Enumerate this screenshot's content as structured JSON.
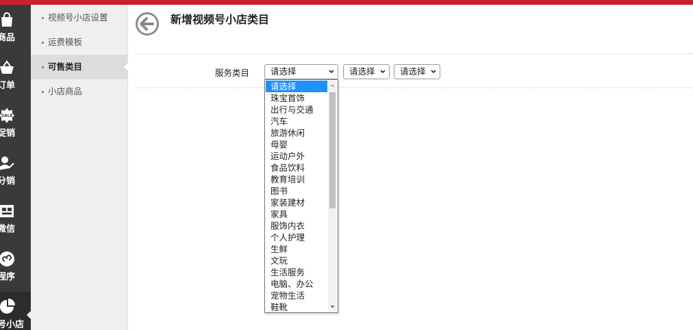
{
  "nav": [
    {
      "label": "商品",
      "icon": "shopping-bag-icon"
    },
    {
      "label": "订单",
      "icon": "basket-icon"
    },
    {
      "label": "促销",
      "icon": "sale-badge-icon"
    },
    {
      "label": "分销",
      "icon": "user-share-icon"
    },
    {
      "label": "微信",
      "icon": "wechat-shop-icon"
    },
    {
      "label": "程序",
      "icon": "mini-program-icon"
    },
    {
      "label": "号小店",
      "icon": "pie-chart-icon"
    }
  ],
  "submenu": [
    {
      "label": "视频号小店设置"
    },
    {
      "label": "运费模板"
    },
    {
      "label": "可售类目"
    },
    {
      "label": "小店商品"
    }
  ],
  "page": {
    "title": "新增视频号小店类目"
  },
  "form": {
    "label": "服务类目",
    "select1": "请选择",
    "select2": "请选择",
    "select3": "请选择"
  },
  "dropdown_options": [
    "请选择",
    "珠宝首饰",
    "出行与交通",
    "汽车",
    "旅游休闲",
    "母婴",
    "运动户外",
    "食品饮料",
    "教育培训",
    "图书",
    "家装建材",
    "家具",
    "服饰内衣",
    "个人护理",
    "生鲜",
    "文玩",
    "生活服务",
    "电脑、办公",
    "宠物生活",
    "鞋靴"
  ],
  "colors": {
    "accent": "#c8202f",
    "selected": "#1e90ff",
    "sidebar": "#3a3a3a"
  }
}
